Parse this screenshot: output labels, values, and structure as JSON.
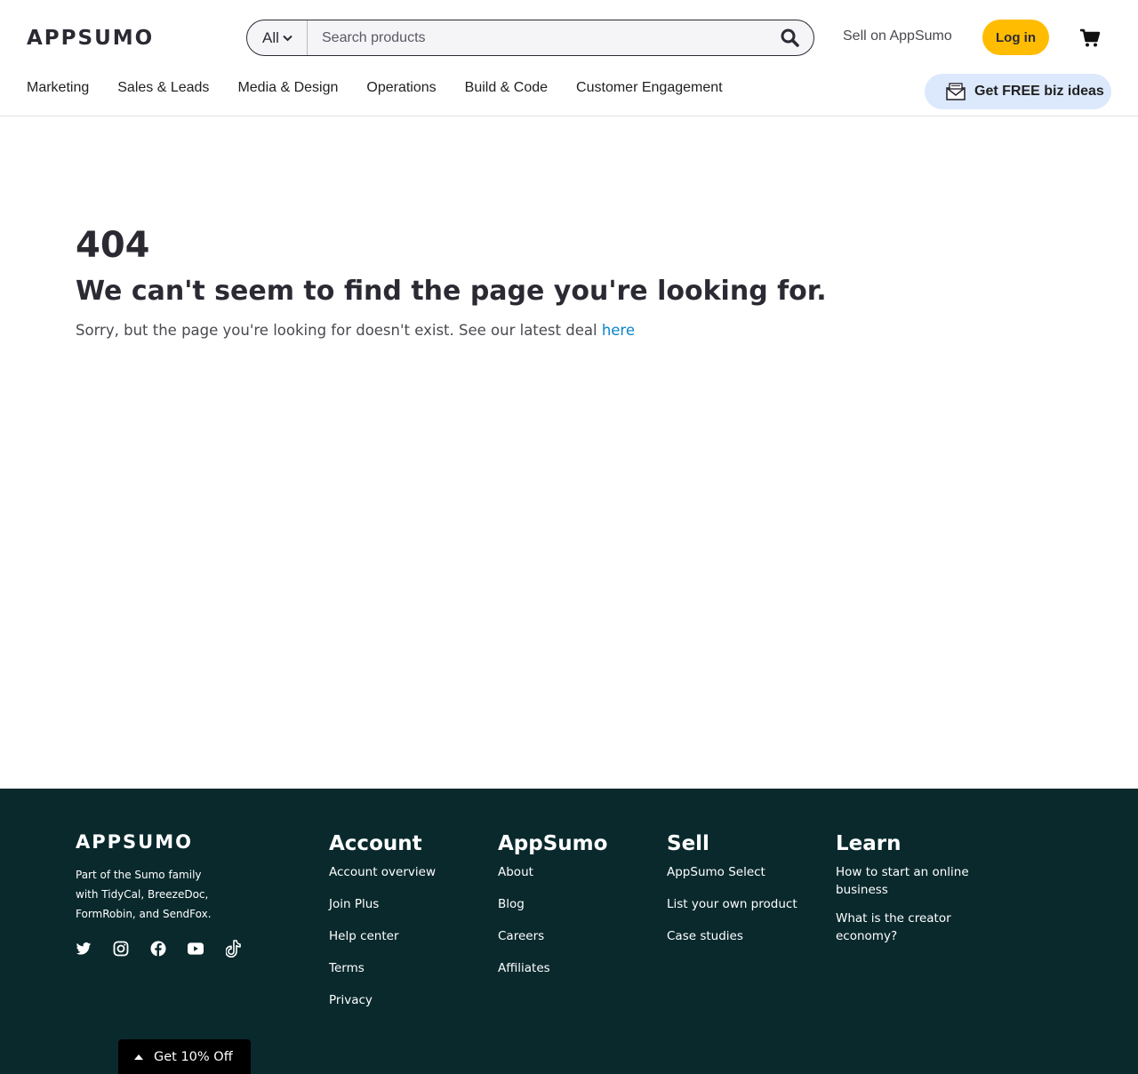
{
  "header": {
    "logo": "APPSUMO",
    "search": {
      "category": "All",
      "placeholder": "Search products"
    },
    "sell_link": "Sell on AppSumo",
    "login": "Log in",
    "nav": [
      "Marketing",
      "Sales & Leads",
      "Media & Design",
      "Operations",
      "Build & Code",
      "Customer Engagement"
    ],
    "biz_ideas": "Get FREE biz ideas"
  },
  "main": {
    "code": "404",
    "headline": "We can't seem to find the page you're looking for.",
    "sorry_text": "Sorry, but the page you're looking for doesn't exist. See our latest deal ",
    "sorry_link": "here"
  },
  "footer": {
    "logo": "APPSUMO",
    "tagline": "Part of the Sumo family with TidyCal, BreezeDoc, FormRobin, and SendFox.",
    "socials": [
      "twitter-icon",
      "instagram-icon",
      "facebook-icon",
      "youtube-icon",
      "tiktok-icon"
    ],
    "columns": {
      "account": {
        "title": "Account",
        "links": [
          "Account overview",
          "Join Plus",
          "Help center",
          "Terms",
          "Privacy"
        ]
      },
      "appsumo": {
        "title": "AppSumo",
        "links": [
          "About",
          "Blog",
          "Careers",
          "Affiliates"
        ]
      },
      "sell": {
        "title": "Sell",
        "links": [
          "AppSumo Select",
          "List your own product",
          "Case studies"
        ]
      },
      "learn": {
        "title": "Learn",
        "links": [
          "How to start an online business",
          "What is the creator economy?"
        ]
      }
    }
  },
  "promo": {
    "label": "Get 10% Off"
  },
  "colors": {
    "brand_yellow": "#ffbc00",
    "footer_bg": "#0a292d",
    "link_blue": "#0a84c8",
    "biz_bg": "#dce9fc"
  }
}
